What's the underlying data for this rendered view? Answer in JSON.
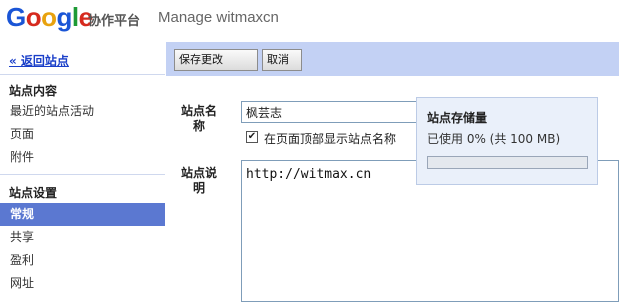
{
  "header": {
    "logo_letters": [
      "G",
      "o",
      "o",
      "g",
      "l",
      "e"
    ],
    "product": "协作平台",
    "site_title": "Manage witmaxcn"
  },
  "sidebar": {
    "back_link": "« 返回站点",
    "content_section": {
      "title": "站点内容",
      "items": [
        "最近的站点活动",
        "页面",
        "附件"
      ]
    },
    "settings_section": {
      "title": "站点设置",
      "items": [
        "常规",
        "共享",
        "盈利",
        "网址"
      ],
      "active": "常规"
    }
  },
  "toolbar": {
    "save_label": "保存更改",
    "cancel_label": "取消"
  },
  "form": {
    "site_name_label": "站点名称",
    "site_name_value": "枫芸志",
    "show_name_checked": true,
    "show_name_label": "在页面顶部显示站点名称",
    "description_label": "站点说明",
    "description_value": "http://witmax.cn"
  },
  "storage": {
    "title": "站点存储量",
    "usage_text": "已使用 0% (共 100 MB)",
    "used_fraction": 0.0
  },
  "colors": {
    "toolbar_bg": "#c3d1f4",
    "active_nav_bg": "#5b78d1",
    "link": "#1a3fc9",
    "storage_bg": "#eaf0fa"
  }
}
